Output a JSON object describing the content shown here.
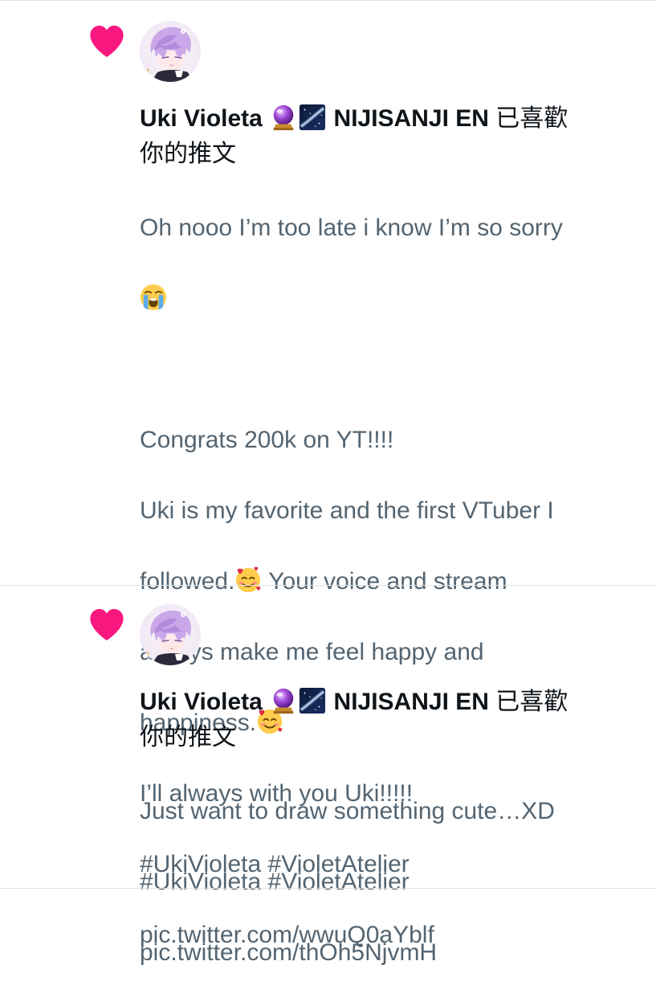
{
  "notifications": [
    {
      "author": "Uki Violeta",
      "org": "NIJISANJI EN",
      "action_suffix": "已喜歡",
      "action_line2": "你的推文",
      "tweet": {
        "line_1a": "Oh nooo I’m too late i know I’m so sorry",
        "line_blank": "",
        "line_2": "Congrats 200k on YT!!!!",
        "line_3": "Uki is my favorite and the first VTuber I",
        "line_4a": "followed.",
        "line_4b": " Your voice and stream",
        "line_5": "always make me feel happy and",
        "line_6a": "happiness.",
        "line_7": "I’ll always with you Uki!!!!!",
        "line_8": "#UkiVioleta #VioletAtelier",
        "line_9": "pic.twitter.com/wwuQ0aYblf"
      },
      "icons": {
        "like": "heart-icon",
        "badge_1": "crystal-ball-emoji",
        "badge_2": "milky-way-emoji",
        "emoji_1": "loudly-crying-face-emoji",
        "emoji_2": "smiling-face-with-hearts-emoji"
      }
    },
    {
      "author": "Uki Violeta",
      "org": "NIJISANJI EN",
      "action_suffix": "已喜歡",
      "action_line2": "你的推文",
      "tweet": {
        "line_1": "Just want to draw something cute…XD",
        "line_2": "#UkiVioleta #VioletAtelier",
        "line_3": "pic.twitter.com/thOh5NjvmH"
      },
      "icons": {
        "like": "heart-icon",
        "badge_1": "crystal-ball-emoji",
        "badge_2": "milky-way-emoji"
      }
    }
  ],
  "colors": {
    "heart": "#f91880",
    "primary_text": "#0f1419",
    "secondary_text": "#536471",
    "divider": "#dfe3e6"
  }
}
